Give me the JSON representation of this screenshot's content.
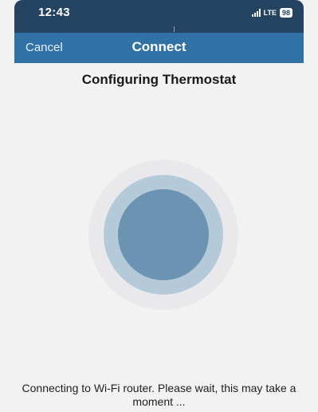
{
  "status_bar": {
    "time": "12:43",
    "network": "LTE",
    "battery": "98",
    "icons": [
      "signal-icon",
      "battery-icon"
    ]
  },
  "nav_bar": {
    "cancel_label": "Cancel",
    "title": "Connect"
  },
  "main": {
    "title": "Configuring Thermostat",
    "message": "Connecting to Wi-Fi router. Please wait, this may take a moment ...",
    "indicator_icon": "pulse-progress-icon"
  },
  "colors": {
    "status_bar_bg": "#234361",
    "nav_bar_bg": "#3172a6",
    "page_bg": "#f2f2f2",
    "ring_outer": "#e9e9eb",
    "ring_middle": "#b4cad9",
    "ring_core": "#6a94b1"
  }
}
